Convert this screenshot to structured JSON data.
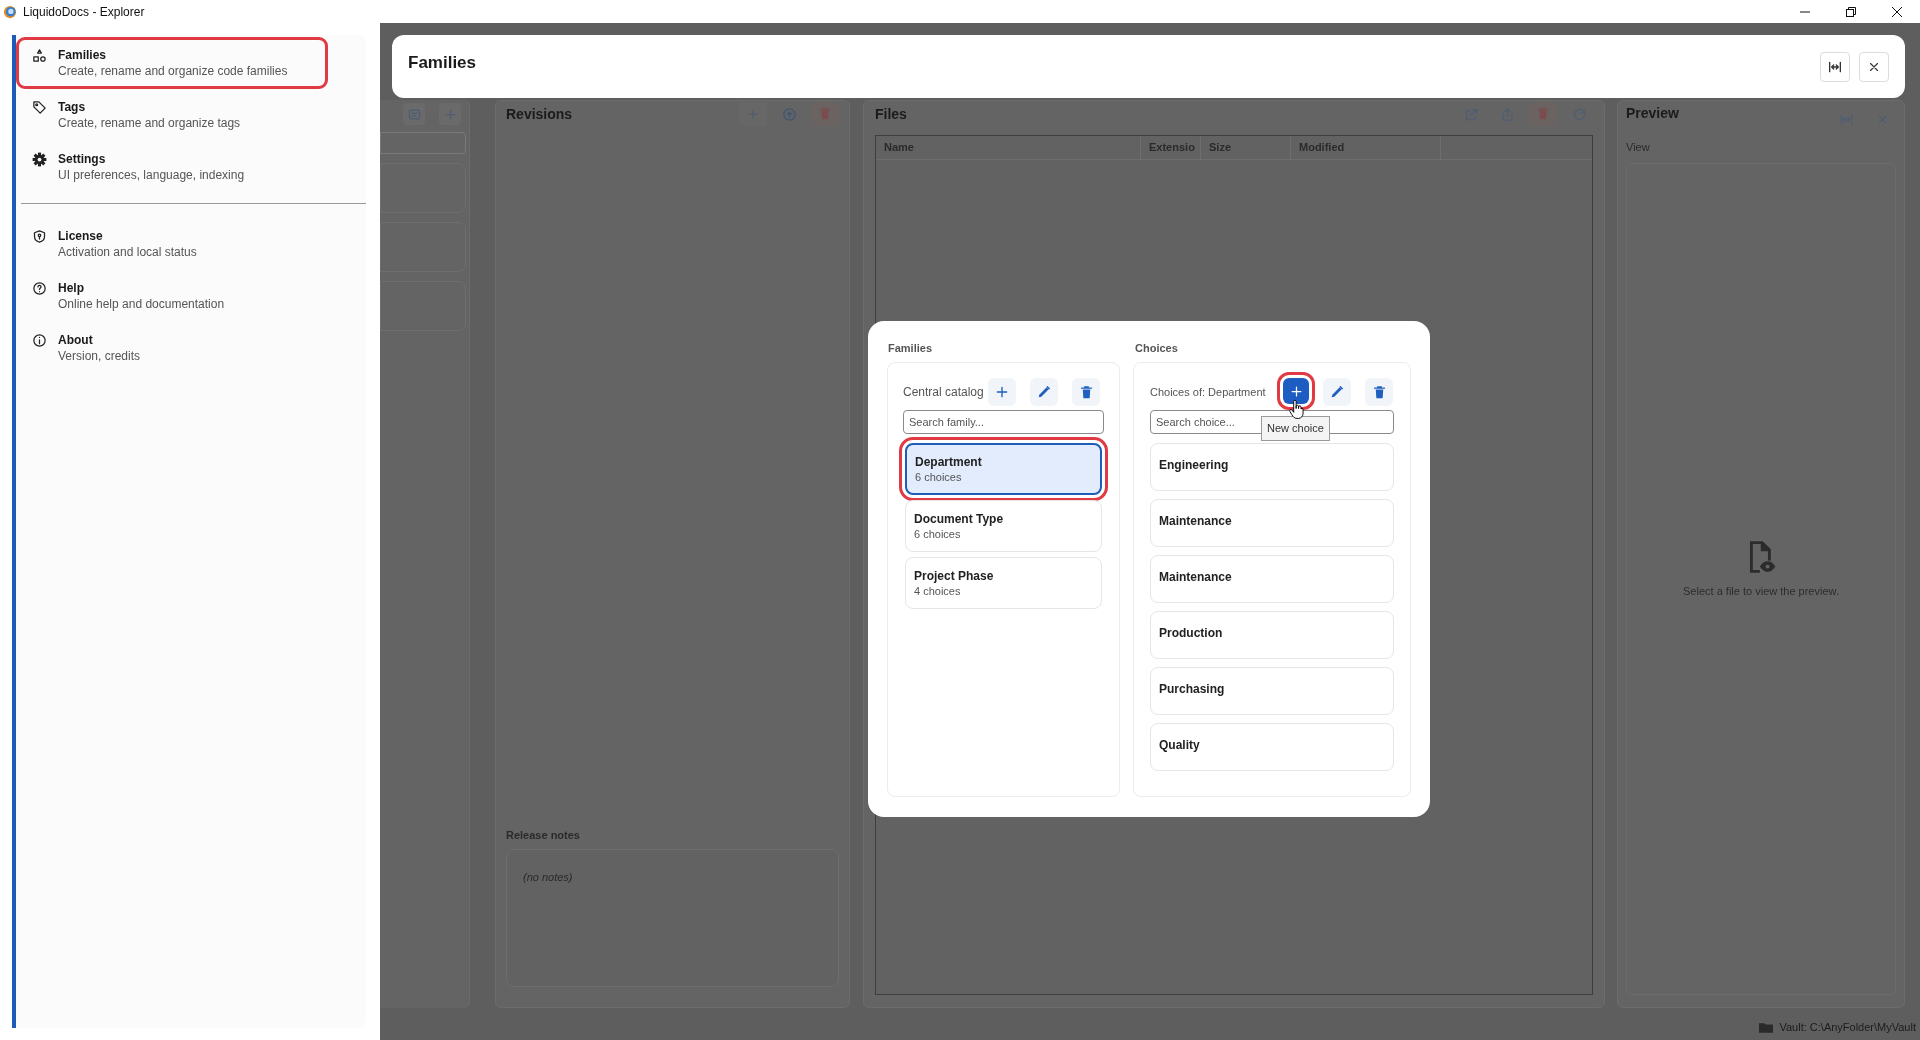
{
  "window": {
    "title": "LiquidoDocs - Explorer"
  },
  "sidebar": {
    "sections": [
      {
        "items": [
          {
            "title": "Families",
            "description": "Create, rename and organize code families",
            "highlighted": true
          },
          {
            "title": "Tags",
            "description": "Create, rename and organize tags",
            "highlighted": false
          },
          {
            "title": "Settings",
            "description": "UI preferences, language, indexing",
            "highlighted": false
          }
        ]
      },
      {
        "items": [
          {
            "title": "License",
            "description": "Activation and local status",
            "highlighted": false
          },
          {
            "title": "Help",
            "description": "Online help and documentation",
            "highlighted": false
          },
          {
            "title": "About",
            "description": "Version, credits",
            "highlighted": false
          }
        ]
      }
    ]
  },
  "header": {
    "title": "Families"
  },
  "revisions": {
    "title": "Revisions",
    "release_notes_label": "Release notes",
    "notes": "(no notes)"
  },
  "files": {
    "title": "Files",
    "columns": [
      "Name",
      "Extensio",
      "Size",
      "Modified"
    ]
  },
  "preview": {
    "title": "Preview",
    "view_label": "View",
    "empty_message": "Select a file to view the preview."
  },
  "dialog": {
    "families": {
      "heading": "Families",
      "catalog_label": "Central catalog",
      "search": {
        "placeholder": "Search family..."
      },
      "items": [
        {
          "name": "Department",
          "count": "6 choices",
          "selected": true,
          "highlighted": true
        },
        {
          "name": "Document Type",
          "count": "6 choices",
          "selected": false,
          "highlighted": false
        },
        {
          "name": "Project Phase",
          "count": "4 choices",
          "selected": false,
          "highlighted": false
        }
      ]
    },
    "choices": {
      "heading": "Choices",
      "label": "Choices of: Department",
      "add_button_highlighted": true,
      "tooltip": "New choice",
      "search": {
        "placeholder": "Search choice..."
      },
      "items": [
        {
          "name": "Engineering"
        },
        {
          "name": "Maintenance"
        },
        {
          "name": "Maintenance"
        },
        {
          "name": "Production"
        },
        {
          "name": "Purchasing"
        },
        {
          "name": "Quality"
        }
      ]
    }
  },
  "status_bar": {
    "vault": "Vault: C:\\AnyFolder\\MyVault"
  }
}
